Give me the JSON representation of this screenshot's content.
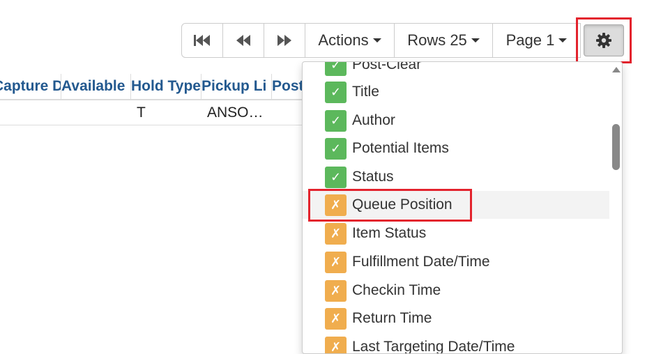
{
  "toolbar": {
    "first_icon": "first-page-icon",
    "prev_icon": "previous-page-icon",
    "next_icon": "next-page-icon",
    "actions_label": "Actions",
    "rows_label": "Rows 25",
    "page_label": "Page 1",
    "settings_icon": "gear-icon"
  },
  "table": {
    "headers": [
      "Capture D",
      "Available",
      "Hold Type",
      "Pickup Li",
      "Post"
    ],
    "row": {
      "hold_type": "T",
      "pickup_lib": "ANSO…"
    }
  },
  "column_menu": {
    "items": [
      {
        "label": "Post-Clear",
        "checked": true
      },
      {
        "label": "Title",
        "checked": true
      },
      {
        "label": "Author",
        "checked": true
      },
      {
        "label": "Potential Items",
        "checked": true
      },
      {
        "label": "Status",
        "checked": true
      },
      {
        "label": "Queue Position",
        "checked": false
      },
      {
        "label": "Item Status",
        "checked": false
      },
      {
        "label": "Fulfillment Date/Time",
        "checked": false
      },
      {
        "label": "Checkin Time",
        "checked": false
      },
      {
        "label": "Return Time",
        "checked": false
      },
      {
        "label": "Last Targeting Date/Time",
        "checked": false
      }
    ],
    "check_glyph": "✓",
    "uncheck_glyph": "✗"
  },
  "colors": {
    "checked": "#5cb85c",
    "unchecked": "#f0ad4e",
    "highlight_border": "#e3232d",
    "header_text": "#23598f"
  }
}
